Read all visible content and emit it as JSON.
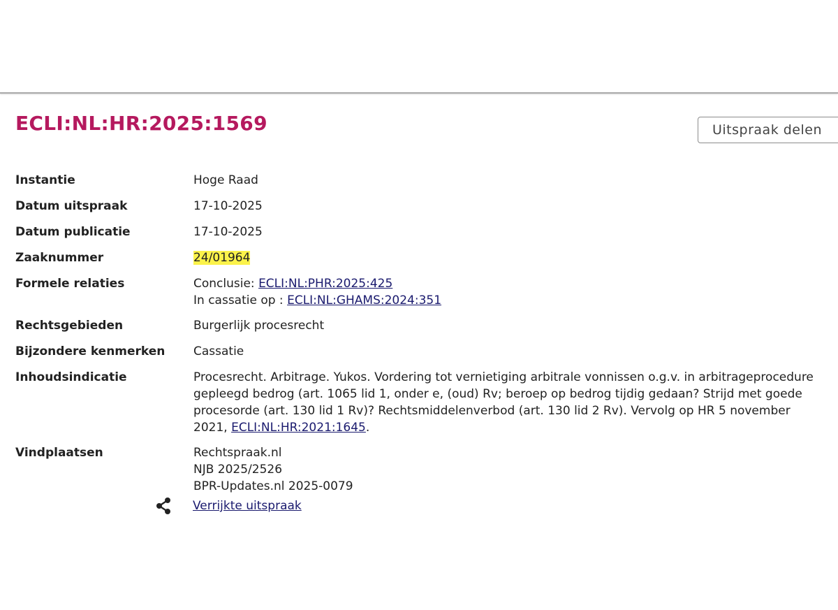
{
  "ruling": {
    "ecli": "ECLI:NL:HR:2025:1569",
    "share_label": "Uitspraak delen"
  },
  "meta": {
    "instantie": {
      "label": "Instantie",
      "value": "Hoge Raad"
    },
    "datum_uitspraak": {
      "label": "Datum uitspraak",
      "value": "17-10-2025"
    },
    "datum_publicatie": {
      "label": "Datum publicatie",
      "value": "17-10-2025"
    },
    "zaaknummer": {
      "label": "Zaaknummer",
      "value": "24/01964"
    },
    "formele_relaties": {
      "label": "Formele relaties",
      "conclusie_prefix": "Conclusie: ",
      "conclusie_link": "ECLI:NL:PHR:2025:425",
      "cassatie_prefix": "In cassatie op : ",
      "cassatie_link": "ECLI:NL:GHAMS:2024:351"
    },
    "rechtsgebieden": {
      "label": "Rechtsgebieden",
      "value": "Burgerlijk procesrecht"
    },
    "bijzondere_kenmerken": {
      "label": "Bijzondere kenmerken",
      "value": "Cassatie"
    },
    "inhoudsindicatie": {
      "label": "Inhoudsindicatie",
      "text": "Procesrecht. Arbitrage. Yukos. Vordering tot vernietiging arbitrale vonnissen o.g.v. in arbitrageprocedure gepleegd bedrog (art. 1065 lid 1, onder e, (oud) Rv; beroep op bedrog tijdig gedaan? Strijd met goede procesorde (art. 130 lid 1 Rv)? Rechtsmiddelenverbod (art. 130 lid 2 Rv). Vervolg op HR 5 november 2021, ",
      "link": "ECLI:NL:HR:2021:1645",
      "suffix": "."
    },
    "vindplaatsen": {
      "label": "Vindplaatsen",
      "items": [
        "Rechtspraak.nl",
        "NJB 2025/2526",
        "BPR-Updates.nl 2025-0079"
      ]
    }
  },
  "enriched": {
    "icon": "share-icon",
    "label": "Verrijkte uitspraak"
  },
  "colors": {
    "title": "#b5195e",
    "link": "#1a1a6e",
    "highlight": "#fbf24a"
  }
}
